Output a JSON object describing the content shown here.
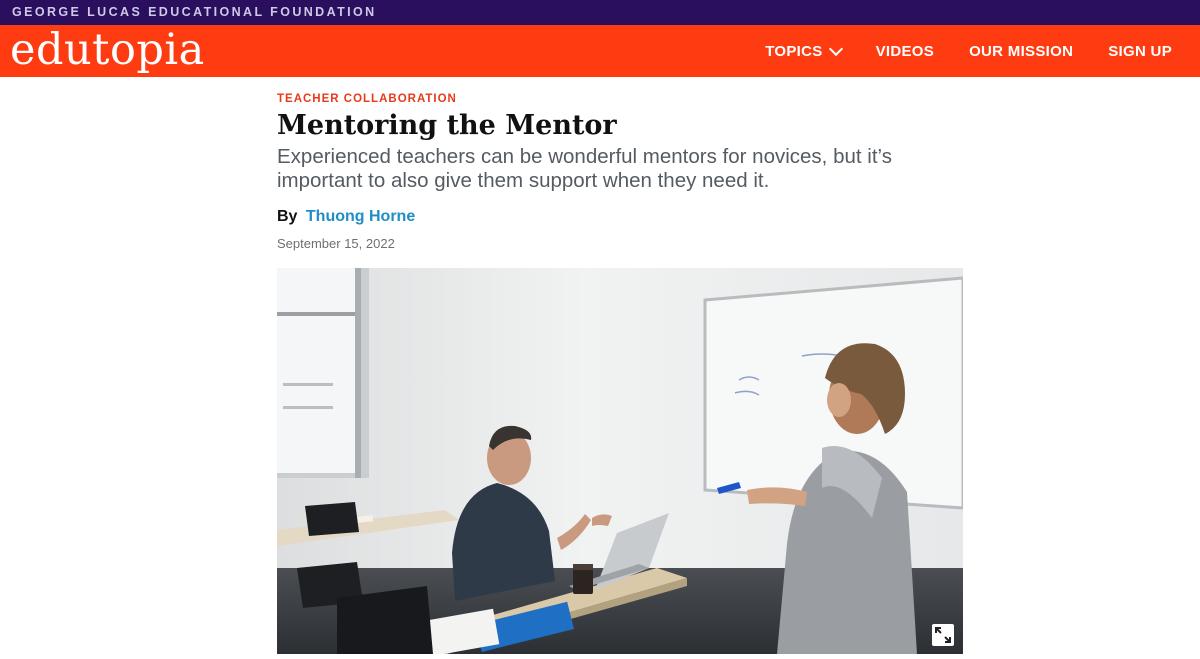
{
  "top_bar": {
    "foundation_name": "GEORGE LUCAS EDUCATIONAL FOUNDATION"
  },
  "header": {
    "logo_text": "edutopia",
    "nav": [
      {
        "label": "TOPICS",
        "has_dropdown": true
      },
      {
        "label": "VIDEOS"
      },
      {
        "label": "OUR MISSION"
      },
      {
        "label": "SIGN UP"
      }
    ]
  },
  "article": {
    "category": "TEACHER COLLABORATION",
    "title": "Mentoring the Mentor",
    "subtitle": "Experienced teachers can be wonderful mentors for novices, but it’s important to also give them support when they need it.",
    "by_label": "By",
    "author": "Thuong Horne",
    "date": "September 15, 2022",
    "hero_image": {
      "icon": "expand-icon"
    }
  },
  "colors": {
    "foundation_bar": "#2a0f5f",
    "header_orange": "#ff3b12",
    "category_red": "#e8391a",
    "author_link": "#1f8ec7"
  }
}
